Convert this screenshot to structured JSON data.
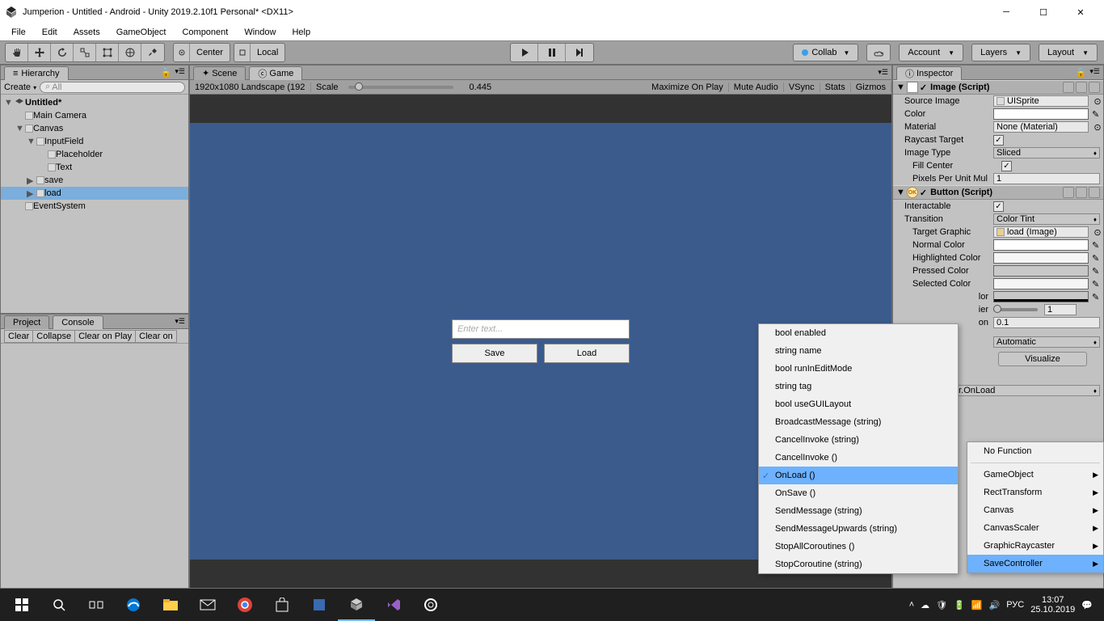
{
  "window": {
    "title": "Jumperion - Untitled - Android - Unity 2019.2.10f1 Personal* <DX11>"
  },
  "menu": {
    "file": "File",
    "edit": "Edit",
    "assets": "Assets",
    "gameobject": "GameObject",
    "component": "Component",
    "window": "Window",
    "help": "Help"
  },
  "toolbar": {
    "center": "Center",
    "local": "Local",
    "collab": "Collab",
    "account": "Account",
    "layers": "Layers",
    "layout": "Layout"
  },
  "hierarchy": {
    "title": "Hierarchy",
    "create": "Create",
    "search_placeholder": "All",
    "scene": "Untitled*",
    "items": {
      "maincam": "Main Camera",
      "canvas": "Canvas",
      "inputfield": "InputField",
      "placeholder": "Placeholder",
      "text": "Text",
      "save": "save",
      "load": "load",
      "eventsys": "EventSystem"
    }
  },
  "project": {
    "tab1": "Project",
    "tab2": "Console",
    "clear": "Clear",
    "collapse": "Collapse",
    "clearplay": "Clear on Play",
    "clearon": "Clear on"
  },
  "gametabs": {
    "scene": "Scene",
    "game": "Game"
  },
  "gamebar": {
    "res": "1920x1080 Landscape (192",
    "scale": "Scale",
    "scale_val": "0.445",
    "maximize": "Maximize On Play",
    "mute": "Mute Audio",
    "vsync": "VSync",
    "stats": "Stats",
    "gizmos": "Gizmos"
  },
  "gamecontent": {
    "placeholder": "Enter text...",
    "save": "Save",
    "load": "Load"
  },
  "inspector": {
    "title": "Inspector",
    "image": {
      "header": "Image (Script)",
      "source": "Source Image",
      "source_val": "UISprite",
      "color": "Color",
      "material": "Material",
      "material_val": "None (Material)",
      "raycast": "Raycast Target",
      "imgtype": "Image Type",
      "imgtype_val": "Sliced",
      "fill": "Fill Center",
      "pixels": "Pixels Per Unit Mul",
      "pixels_val": "1"
    },
    "button": {
      "header": "Button (Script)",
      "interactable": "Interactable",
      "transition": "Transition",
      "transition_val": "Color Tint",
      "target": "Target Graphic",
      "target_val": "load (Image)",
      "normal": "Normal Color",
      "highlighted": "Highlighted Color",
      "pressed": "Pressed Color",
      "selected": "Selected Color",
      "cutoff_color": "lor",
      "cutoff_mult": "ier",
      "cutoff_dur": "on",
      "mult_val": "1",
      "dur_val": "0.1",
      "auto": "Automatic",
      "visualize": "Visualize",
      "event_target": "SaveController.OnLoad"
    }
  },
  "ctx1": {
    "items": [
      "bool enabled",
      "string name",
      "bool runInEditMode",
      "string tag",
      "bool useGUILayout",
      "BroadcastMessage (string)",
      "CancelInvoke (string)",
      "CancelInvoke ()",
      "OnLoad ()",
      "OnSave ()",
      "SendMessage (string)",
      "SendMessageUpwards (string)",
      "StopAllCoroutines ()",
      "StopCoroutine (string)"
    ]
  },
  "ctx2": {
    "nofunc": "No Function",
    "items": [
      "GameObject",
      "RectTransform",
      "Canvas",
      "CanvasScaler",
      "GraphicRaycaster",
      "SaveController"
    ]
  },
  "taskbar": {
    "lang": "РУС",
    "time": "13:07",
    "date": "25.10.2019"
  }
}
